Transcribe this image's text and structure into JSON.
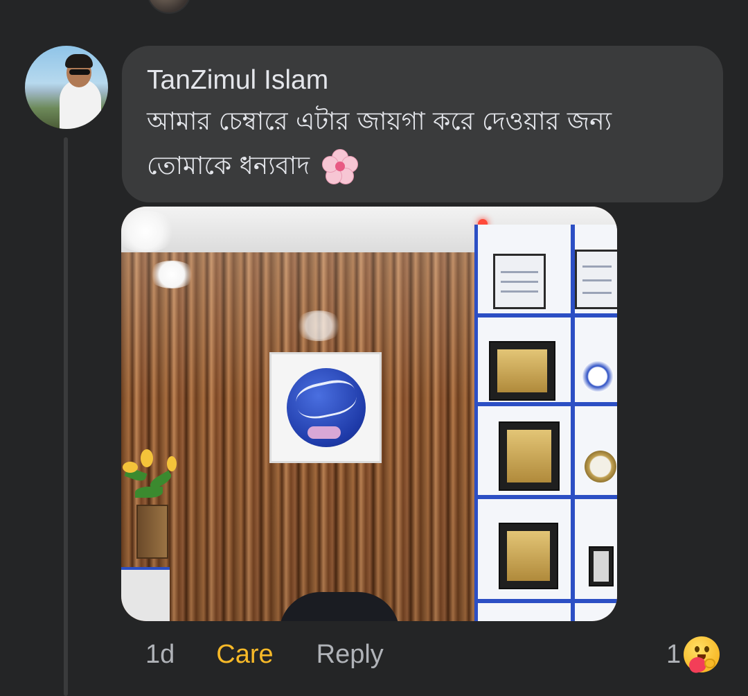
{
  "comment": {
    "author": "TanZimul Islam",
    "text": "আমার চেম্বারে এটার জায়গা করে দেওয়ার জন্য তোমাকে ধন্যবাদ",
    "emoji_icon": "cherry-blossom-icon"
  },
  "actions": {
    "time": "1d",
    "reaction": "Care",
    "reply": "Reply",
    "reaction_count": "1",
    "reaction_icon": "care-emoji-icon"
  },
  "colors": {
    "background": "#242526",
    "bubble": "#3a3b3c",
    "care_accent": "#f7b928",
    "muted_text": "#b0b3b8"
  }
}
